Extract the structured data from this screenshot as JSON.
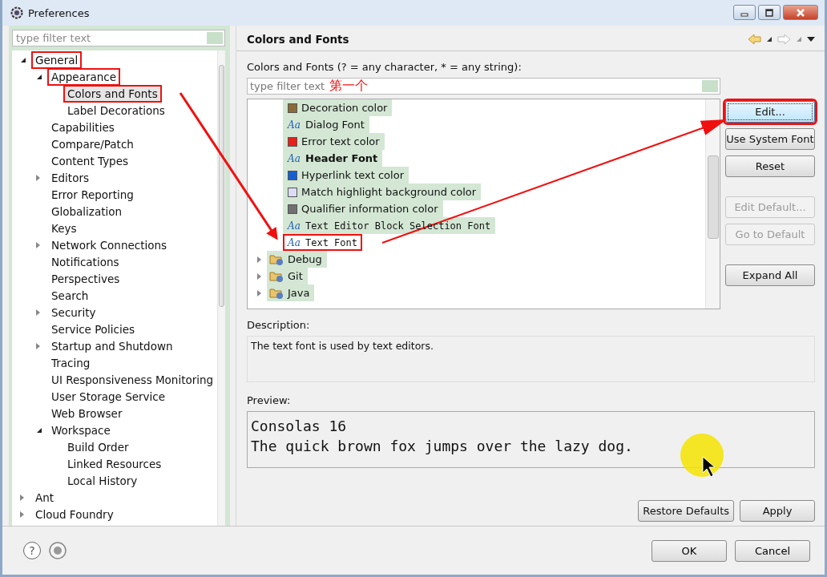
{
  "window": {
    "title": "Preferences"
  },
  "sidebar": {
    "filter": {
      "placeholder": "type filter text"
    },
    "tree": [
      {
        "label": "General",
        "expanded": true,
        "selected": false,
        "marked": true,
        "children": [
          {
            "label": "Appearance",
            "expanded": true,
            "selected": false,
            "marked": true,
            "children": [
              {
                "label": "Colors and Fonts",
                "selected": true,
                "marked": true
              },
              {
                "label": "Label Decorations",
                "selected": false,
                "marked": false
              }
            ]
          },
          {
            "label": "Capabilities",
            "selected": false,
            "marked": false
          },
          {
            "label": "Compare/Patch",
            "selected": false,
            "marked": false
          },
          {
            "label": "Content Types",
            "selected": false,
            "marked": false
          },
          {
            "label": "Editors",
            "expandable": true,
            "expanded": false,
            "selected": false,
            "marked": false
          },
          {
            "label": "Error Reporting",
            "selected": false,
            "marked": false
          },
          {
            "label": "Globalization",
            "selected": false,
            "marked": false
          },
          {
            "label": "Keys",
            "selected": false,
            "marked": false
          },
          {
            "label": "Network Connections",
            "expandable": true,
            "expanded": false,
            "selected": false,
            "marked": false
          },
          {
            "label": "Notifications",
            "selected": false,
            "marked": false
          },
          {
            "label": "Perspectives",
            "selected": false,
            "marked": false
          },
          {
            "label": "Search",
            "selected": false,
            "marked": false
          },
          {
            "label": "Security",
            "expandable": true,
            "expanded": false,
            "selected": false,
            "marked": false
          },
          {
            "label": "Service Policies",
            "selected": false,
            "marked": false
          },
          {
            "label": "Startup and Shutdown",
            "expandable": true,
            "expanded": false,
            "selected": false,
            "marked": false
          },
          {
            "label": "Tracing",
            "selected": false,
            "marked": false
          },
          {
            "label": "UI Responsiveness Monitoring",
            "selected": false,
            "marked": false
          },
          {
            "label": "User Storage Service",
            "selected": false,
            "marked": false
          },
          {
            "label": "Web Browser",
            "selected": false,
            "marked": false
          },
          {
            "label": "Workspace",
            "expanded": true,
            "selected": false,
            "marked": false,
            "children": [
              {
                "label": "Build Order",
                "selected": false,
                "marked": false
              },
              {
                "label": "Linked Resources",
                "selected": false,
                "marked": false
              },
              {
                "label": "Local History",
                "selected": false,
                "marked": false
              }
            ]
          }
        ]
      },
      {
        "label": "Ant",
        "expandable": true,
        "expanded": false,
        "selected": false,
        "marked": false
      },
      {
        "label": "Cloud Foundry",
        "expandable": true,
        "expanded": false,
        "selected": false,
        "marked": false
      }
    ]
  },
  "page": {
    "title": "Colors and Fonts",
    "filter_label": "Colors and Fonts (? = any character, * = any string):",
    "filter": {
      "placeholder": "type filter text",
      "annotation": "第一个"
    },
    "items": [
      {
        "kind": "color",
        "label": "Decoration color",
        "color": "#8b6a3a",
        "selected": false,
        "marked": false
      },
      {
        "kind": "font",
        "icon": "Aa",
        "label": "Dialog Font",
        "selected": false,
        "marked": false
      },
      {
        "kind": "color",
        "label": "Error text color",
        "color": "#e8201a",
        "selected": false,
        "marked": false
      },
      {
        "kind": "boldfont",
        "icon": "Aa",
        "label": "Header Font",
        "selected": false,
        "marked": false
      },
      {
        "kind": "color",
        "label": "Hyperlink text color",
        "color": "#1560d0",
        "selected": false,
        "marked": false
      },
      {
        "kind": "color",
        "label": "Match highlight background color",
        "color": "#dcdcf4",
        "selected": false,
        "marked": false
      },
      {
        "kind": "color",
        "label": "Qualifier information color",
        "color": "#707070",
        "selected": false,
        "marked": false
      },
      {
        "kind": "monofont",
        "icon": "Aa",
        "label": "Text Editor Block Selection Font",
        "selected": false,
        "marked": false
      },
      {
        "kind": "monofont",
        "icon": "Aa",
        "label": "Text Font",
        "selected": true,
        "marked": true
      },
      {
        "kind": "category",
        "label": "Debug",
        "expanded": false,
        "selected": false,
        "marked": false
      },
      {
        "kind": "category",
        "label": "Git",
        "expanded": false,
        "selected": false,
        "marked": false
      },
      {
        "kind": "category",
        "label": "Java",
        "expanded": false,
        "selected": false,
        "marked": false
      }
    ],
    "buttons": [
      {
        "label": "Edit...",
        "disabled": false,
        "focused": true,
        "marked": true
      },
      {
        "label": "Use System Font",
        "disabled": false,
        "focused": false,
        "marked": false
      },
      {
        "label": "Reset",
        "disabled": false,
        "focused": false,
        "marked": false
      },
      {
        "label": "Edit Default...",
        "disabled": true,
        "focused": false,
        "marked": false
      },
      {
        "label": "Go to Default",
        "disabled": true,
        "focused": false,
        "marked": false
      },
      {
        "label": "Expand All",
        "disabled": false,
        "focused": false,
        "marked": false
      }
    ],
    "description_label": "Description:",
    "description": "The text font is used by text editors.",
    "preview_label": "Preview:",
    "preview": [
      "Consolas 16",
      "The quick brown fox jumps over the lazy dog."
    ],
    "actions": [
      "Restore Defaults",
      "Apply"
    ]
  },
  "footer": {
    "help_icon": "?",
    "buttons": [
      "OK",
      "Cancel"
    ]
  }
}
